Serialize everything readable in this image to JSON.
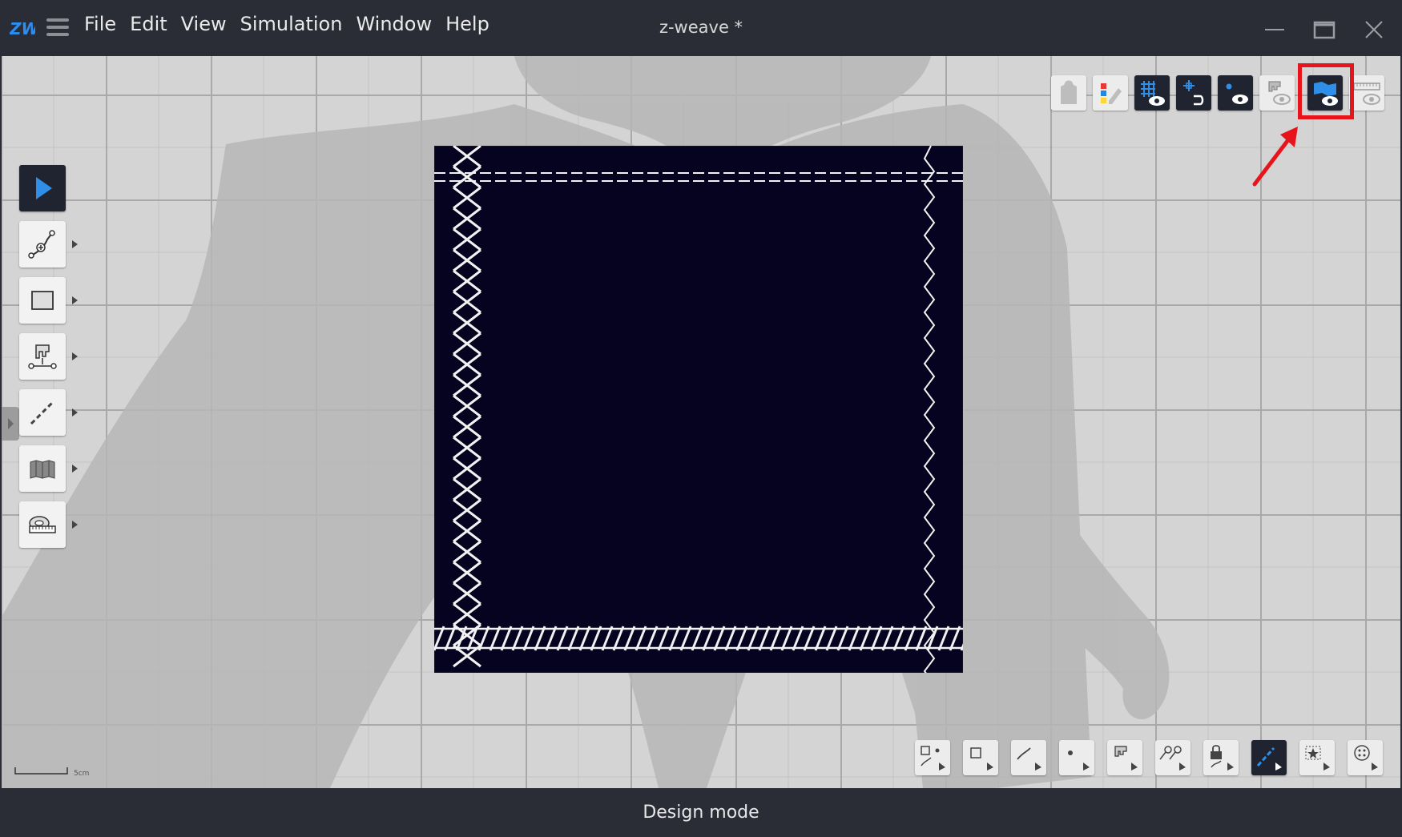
{
  "window": {
    "title": "z-weave *",
    "logo_text": "ZW"
  },
  "menu": {
    "items": [
      "File",
      "Edit",
      "View",
      "Simulation",
      "Window",
      "Help"
    ]
  },
  "left_toolbar": {
    "tools": [
      {
        "name": "select-tool",
        "icon": "arrow-pointer-icon",
        "active": true
      },
      {
        "name": "curve-edit-tool",
        "icon": "curve-point-icon"
      },
      {
        "name": "rectangle-tool",
        "icon": "rectangle-icon"
      },
      {
        "name": "sewing-tool",
        "icon": "sewing-machine-icon"
      },
      {
        "name": "seam-line-tool",
        "icon": "dashed-line-icon"
      },
      {
        "name": "pleat-tool",
        "icon": "pleat-icon"
      },
      {
        "name": "measure-tool",
        "icon": "tape-measure-icon"
      }
    ]
  },
  "view_toolbar": {
    "buttons": [
      {
        "name": "avatar-visibility",
        "icon": "avatar-icon"
      },
      {
        "name": "color-visibility",
        "icon": "color-swatch-icon"
      },
      {
        "name": "grid-visibility",
        "icon": "grid-eye-icon",
        "active": true
      },
      {
        "name": "snap-visibility",
        "icon": "snap-point-eye-icon",
        "active": true
      },
      {
        "name": "point-visibility",
        "icon": "point-eye-icon",
        "active": true
      },
      {
        "name": "sewing-visibility",
        "icon": "sewing-eye-icon"
      },
      {
        "name": "fabric-visibility",
        "icon": "fabric-eye-icon",
        "active": true,
        "highlighted": true
      },
      {
        "name": "ruler-visibility",
        "icon": "ruler-eye-icon"
      }
    ],
    "highlight_color": "#e8141b"
  },
  "bottom_toolbar": {
    "buttons": [
      {
        "name": "select-all-filter",
        "icon": "shape-point-curve-icon"
      },
      {
        "name": "shape-filter",
        "icon": "square-icon"
      },
      {
        "name": "curve-filter",
        "icon": "curve-icon"
      },
      {
        "name": "point-filter",
        "icon": "dot-icon"
      },
      {
        "name": "sewing-filter",
        "icon": "sewing-icon"
      },
      {
        "name": "pin-filter",
        "icon": "pin-icon"
      },
      {
        "name": "lock-filter",
        "icon": "lock-icon"
      },
      {
        "name": "seam-filter",
        "icon": "seam-line-icon",
        "active": true
      },
      {
        "name": "symbol-filter",
        "icon": "star-box-icon"
      },
      {
        "name": "button-filter",
        "icon": "button-icon"
      }
    ]
  },
  "canvas": {
    "scale_label": "5cm",
    "fabric_color": "#05031f",
    "stitch_color": "#f2f2f2"
  },
  "status": {
    "mode": "Design mode"
  }
}
